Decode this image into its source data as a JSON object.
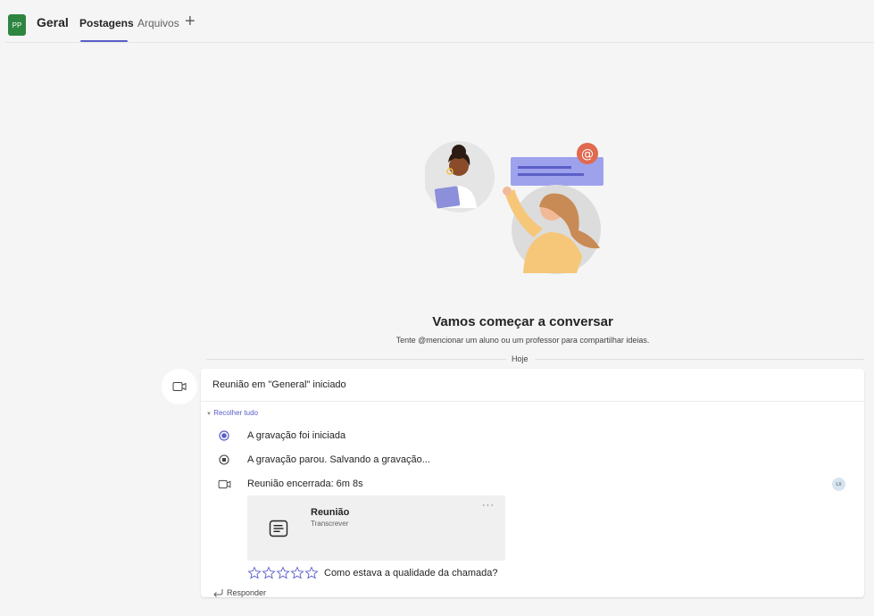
{
  "header": {
    "team_initials": "PP",
    "channel_name": "Geral",
    "tabs": [
      {
        "label": "Postagens"
      },
      {
        "label": "Arquivos"
      }
    ],
    "add_tab_glyph": "+"
  },
  "welcome": {
    "title": "Vamos começar a conversar",
    "subtitle": "Tente @mencionar um aluno ou um professor para compartilhar ideias."
  },
  "date_divider": "Hoje",
  "meeting": {
    "title": "Reunião em \"General\" iniciado",
    "collapse_label": "Recolher tudo",
    "events": [
      {
        "icon": "radio-selected-icon",
        "text": "A gravação foi iniciada"
      },
      {
        "icon": "stop-circle-icon",
        "text": "A gravação parou. Salvando a gravação..."
      },
      {
        "icon": "video-camera-icon",
        "text": "Reunião encerrada: 6m 8s"
      }
    ],
    "participant_initials": "LX",
    "recording": {
      "title": "Reunião",
      "subtitle": "Transcrever",
      "more": "···"
    },
    "rating_question": "Como estava a qualidade da chamada?",
    "reply_label": "Responder"
  },
  "colors": {
    "accent": "#5b5fc7",
    "team_avatar": "#2e8540"
  }
}
